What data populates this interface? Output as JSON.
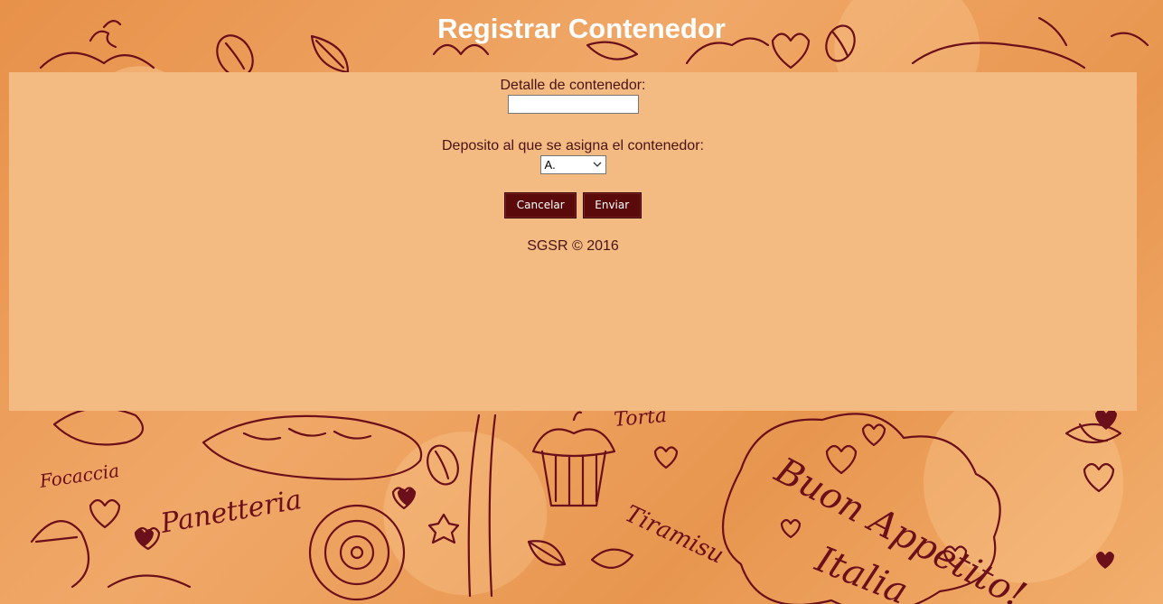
{
  "page": {
    "title": "Registrar Contenedor"
  },
  "form": {
    "detail_label": "Detalle de contenedor:",
    "detail_value": "",
    "deposit_label": "Deposito al que se asigna el contenedor:",
    "deposit_selected": "A."
  },
  "buttons": {
    "cancel_label": "Cancelar",
    "send_label": "Enviar"
  },
  "footer": {
    "text": "SGSR © 2016"
  },
  "background": {
    "decorative_words": [
      "Focaccia",
      "Panetteria",
      "Tiramisu",
      "Torta",
      "Buon Appetito!",
      "Italia"
    ]
  },
  "colors": {
    "background": "#e99a55",
    "panel": "#f3ba82",
    "button": "#5a0a0a",
    "text": "#4a1212",
    "doodle_ink": "#6b0f1a"
  }
}
